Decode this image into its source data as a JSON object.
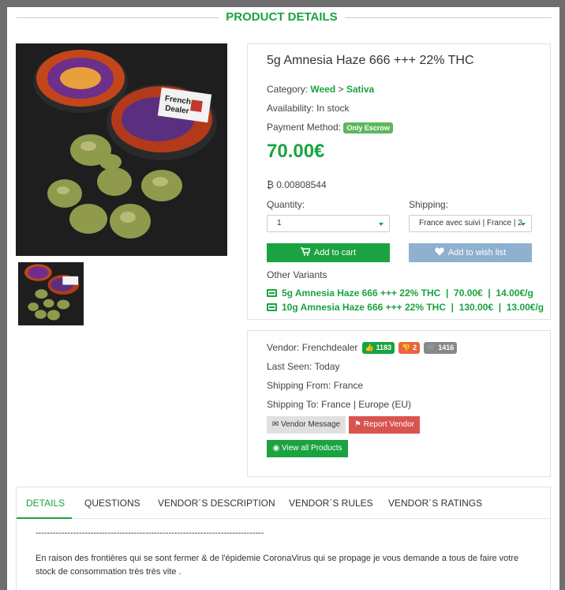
{
  "header": {
    "title": "PRODUCT DETAILS"
  },
  "product": {
    "title": "5g Amnesia Haze 666 +++ 22% THC",
    "category_label": "Category:",
    "category_parent": "Weed",
    "category_sep": ">",
    "category_child": "Sativa",
    "availability": "Availability: In stock",
    "payment_label": "Payment Method:",
    "payment_badge": "Only Escrow",
    "price": "70.00€",
    "btc_symbol": "₿",
    "btc_price": "0.00808544",
    "quantity_label": "Quantity:",
    "quantity_value": "1",
    "shipping_label": "Shipping:",
    "shipping_value": "France avec suivi | France | 2",
    "add_to_cart": "Add to cart",
    "add_to_wish": "Add to wish list",
    "variants_label": "Other Variants",
    "variants": [
      {
        "text": "5g Amnesia Haze 666 +++ 22% THC  |  70.00€  |  14.00€/g"
      },
      {
        "text": "10g Amnesia Haze 666 +++ 22% THC  |  130.00€  |  13.00€/g"
      }
    ]
  },
  "vendor": {
    "label": "Vendor: Frenchdealer",
    "thumbs_up": "1183",
    "thumbs_down": "2",
    "orders": "1416",
    "last_seen": "Last Seen: Today",
    "ship_from": "Shipping From: France",
    "ship_to": "Shipping To: France | Europe (EU)",
    "message_btn": "Vendor Message",
    "report_btn": "Report Vendor",
    "all_products_btn": "View all Products"
  },
  "image_labels": {
    "sticker_line1": "French",
    "sticker_line2": "Dealer"
  },
  "tabs": [
    {
      "label": "DETAILS"
    },
    {
      "label": "QUESTIONS"
    },
    {
      "label": "VENDOR´S DESCRIPTION"
    },
    {
      "label": "VENDOR´S RULES"
    },
    {
      "label": "VENDOR´S RATINGS"
    }
  ],
  "description": {
    "rule": "-------------------------------------------------------------------------------",
    "line1": "En raison des frontières qui se sont fermer & de l'épidemie CoronaVirus qui se propage je vous demande a tous de faire votre",
    "line2": "stock de consommation très très vite ."
  },
  "colors": {
    "accent": "#1aa340",
    "wish": "#8fb0cf",
    "report": "#d9534f",
    "downvote": "#e8663f"
  }
}
